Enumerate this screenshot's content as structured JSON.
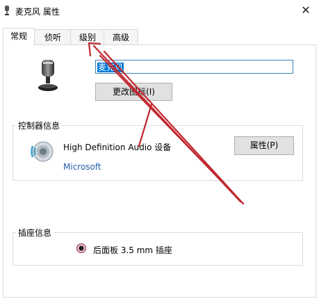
{
  "window": {
    "title": "麦克风 属性",
    "close_glyph": "✕"
  },
  "tabs": [
    {
      "label": "常规",
      "active": true
    },
    {
      "label": "侦听",
      "active": false
    },
    {
      "label": "级别",
      "active": false
    },
    {
      "label": "高级",
      "active": false
    }
  ],
  "general": {
    "device_name_value": "麦克风",
    "change_icon_button": "更改图标(I)"
  },
  "controller": {
    "group_label": "控制器信息",
    "device": "High Definition Audio 设备",
    "vendor": "Microsoft",
    "properties_button": "属性(P)"
  },
  "jack": {
    "group_label": "插座信息",
    "text": "后面板 3.5 mm 插座"
  },
  "colors": {
    "accent_selection": "#0078d7",
    "annotation_arrow": "#c0282e",
    "vendor_link": "#1e5ba8"
  },
  "icons": {
    "title": "microphone-icon",
    "device": "microphone-icon",
    "controller": "speaker-icon",
    "jack": "audio-jack-icon",
    "close": "close-icon"
  }
}
